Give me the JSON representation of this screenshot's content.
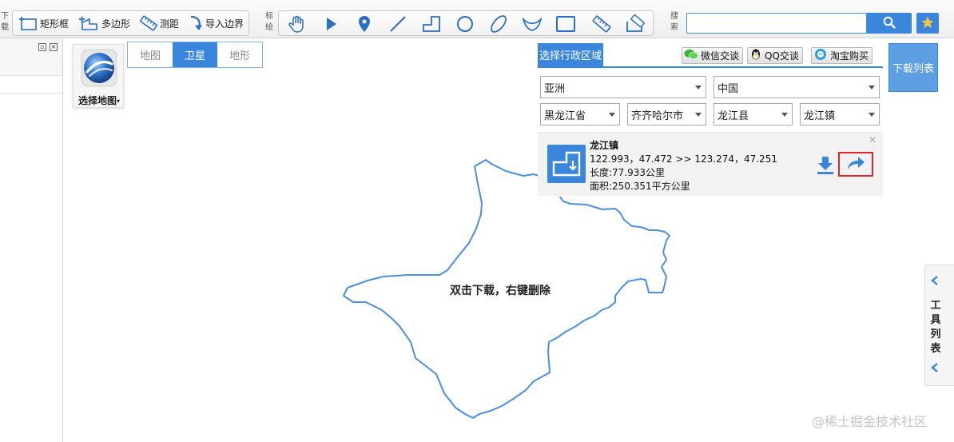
{
  "toolbar": {
    "section_labels": {
      "download": [
        "下",
        "载"
      ],
      "mark": [
        "标",
        "绘"
      ],
      "search": [
        "搜",
        "索"
      ]
    },
    "buttons": {
      "rect": "矩形框",
      "polygon": "多边形",
      "measure": "测距",
      "import": "导入边界"
    },
    "search_placeholder": ""
  },
  "map": {
    "picker_label": "选择地图",
    "types": [
      "地图",
      "卫星",
      "地形"
    ],
    "active_type": "卫星",
    "hint": "双击下载，右键删除"
  },
  "region_panel": {
    "title": "选择行政区域",
    "social": {
      "wechat": "微信交谈",
      "qq": "QQ交谈",
      "taobao": "淘宝购买"
    },
    "selects": {
      "continent": "亚洲",
      "country": "中国",
      "province": "黑龙江省",
      "city": "齐齐哈尔市",
      "county": "龙江县",
      "town": "龙江镇"
    },
    "result": {
      "name": "龙江镇",
      "coords": "122.993，47.472 >> 123.274，47.251",
      "length": "长度:77.933公里",
      "area": "面积:250.351平方公里"
    }
  },
  "download_list_label": "下载列表",
  "tool_tab_label": [
    "工",
    "具",
    "列",
    "表"
  ],
  "watermark": "@稀土掘金技术社区",
  "colors": {
    "accent": "#3a86dd",
    "boundary": "#4a8fe0",
    "highlight": "#e0282a"
  }
}
